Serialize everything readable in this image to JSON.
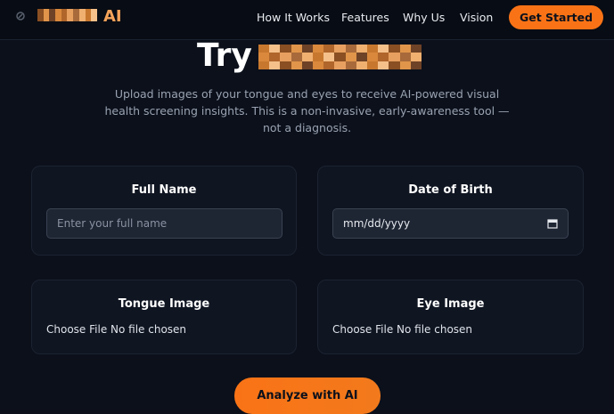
{
  "nav": {
    "brand_suffix": "AI",
    "links": [
      "How It Works",
      "Features",
      "Why Us",
      "Vision"
    ],
    "cta_label": "Get Started"
  },
  "hero": {
    "title_prefix": "Try",
    "subtitle": "Upload images of your tongue and eyes to receive AI-powered visual health screening insights. This is a non-invasive, early-awareness tool — not a diagnosis."
  },
  "form": {
    "full_name": {
      "label": "Full Name",
      "placeholder": "Enter your full name"
    },
    "dob": {
      "label": "Date of Birth",
      "placeholder": "mm/dd/yyyy"
    },
    "tongue": {
      "label": "Tongue Image",
      "button": "Choose File",
      "status": "No file chosen"
    },
    "eye": {
      "label": "Eye Image",
      "button": "Choose File",
      "status": "No file chosen"
    },
    "submit_label": "Analyze with AI"
  },
  "colors": {
    "accent": "#f97316",
    "background": "#0b101b",
    "card": "#0f1521"
  }
}
